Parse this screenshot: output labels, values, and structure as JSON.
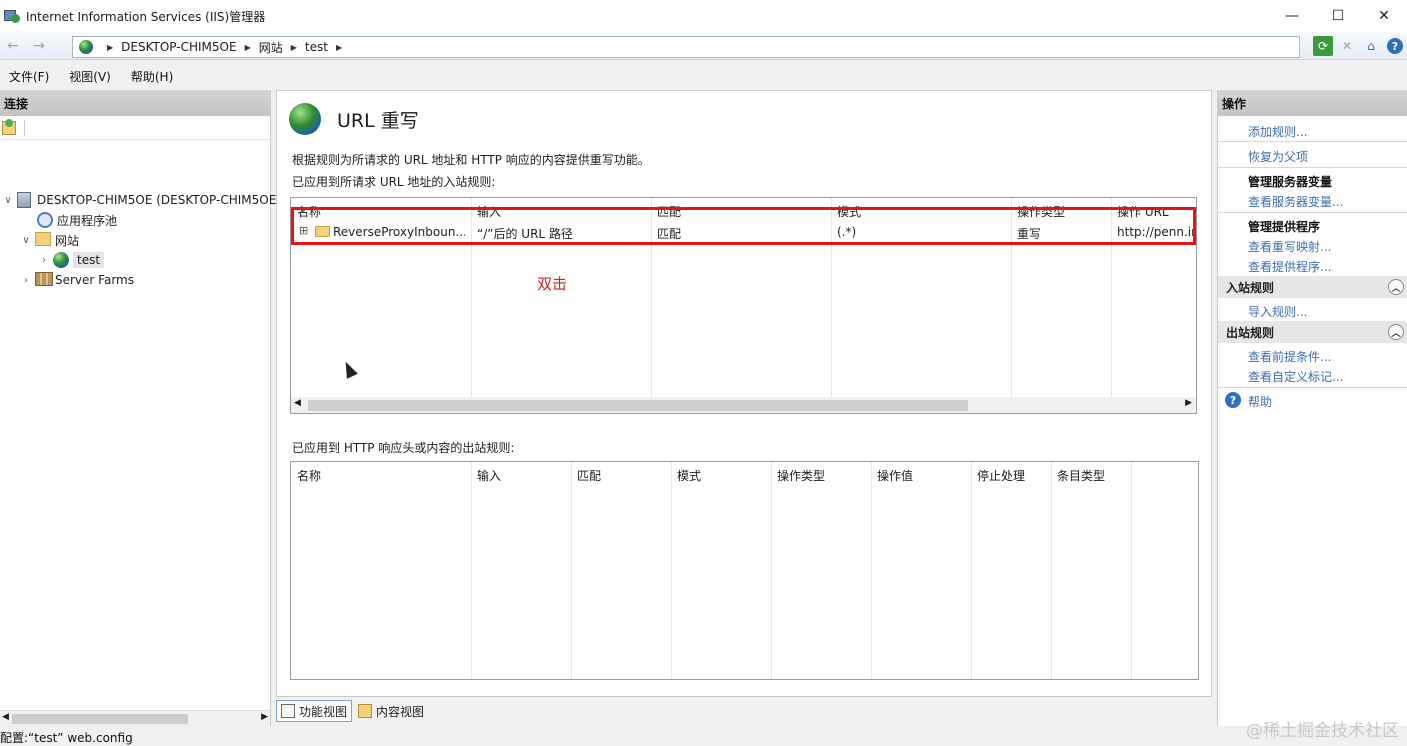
{
  "window": {
    "title": "Internet Information Services (IIS)管理器",
    "controls": {
      "minimize": "—",
      "maximize": "☐",
      "close": "✕"
    }
  },
  "address": {
    "back_icon": "←",
    "forward_icon": "→",
    "crumbs": [
      "DESKTOP-CHIM5OE",
      "网站",
      "test"
    ]
  },
  "menu": [
    "文件(F)",
    "视图(V)",
    "帮助(H)"
  ],
  "connections": {
    "header": "连接",
    "tree": [
      {
        "label": "DESKTOP-CHIM5OE (DESKTOP-CHIM5OE",
        "toggle": "∨",
        "icon": "server-icon"
      },
      {
        "label": "应用程序池",
        "toggle": "",
        "icon": "app-pool-icon"
      },
      {
        "label": "网站",
        "toggle": "∨",
        "icon": "sites-folder-icon"
      },
      {
        "label": "test",
        "toggle": "›",
        "icon": "globe-icon"
      },
      {
        "label": "Server Farms",
        "toggle": "›",
        "icon": "server-farm-icon"
      }
    ]
  },
  "main": {
    "title": "URL 重写",
    "description": "根据规则为所请求的 URL 地址和 HTTP 响应的内容提供重写功能。",
    "inbound_heading": "已应用到所请求 URL 地址的入站规则:",
    "inbound_columns": [
      "名称",
      "输入",
      "匹配",
      "模式",
      "操作类型",
      "操作 URL"
    ],
    "inbound_rows": [
      {
        "expand": "⊞",
        "name": "ReverseProxyInboun...",
        "input": "“/”后的 URL 路径",
        "match": "匹配",
        "pattern": "(.*)",
        "action_type": "重写",
        "action_url": "http://penn.in"
      }
    ],
    "annotation": "双击",
    "outbound_heading": "已应用到 HTTP 响应头或内容的出站规则:",
    "outbound_columns": [
      "名称",
      "输入",
      "匹配",
      "模式",
      "操作类型",
      "操作值",
      "停止处理",
      "条目类型"
    ]
  },
  "views": {
    "feature": "功能视图",
    "content": "内容视图"
  },
  "actions": {
    "header": "操作",
    "add_rule": "添加规则...",
    "revert_parent": "恢复为父项",
    "server_vars_heading": "管理服务器变量",
    "view_server_vars": "查看服务器变量...",
    "providers_heading": "管理提供程序",
    "view_rewrite_maps": "查看重写映射...",
    "view_providers": "查看提供程序...",
    "inbound_heading": "入站规则",
    "import_rules": "导入规则...",
    "outbound_heading": "出站规则",
    "view_preconditions": "查看前提条件...",
    "view_custom_tags": "查看自定义标记...",
    "help": "帮助"
  },
  "status": {
    "text": "配置:“test” web.config"
  },
  "watermark": "@稀土掘金技术社区"
}
